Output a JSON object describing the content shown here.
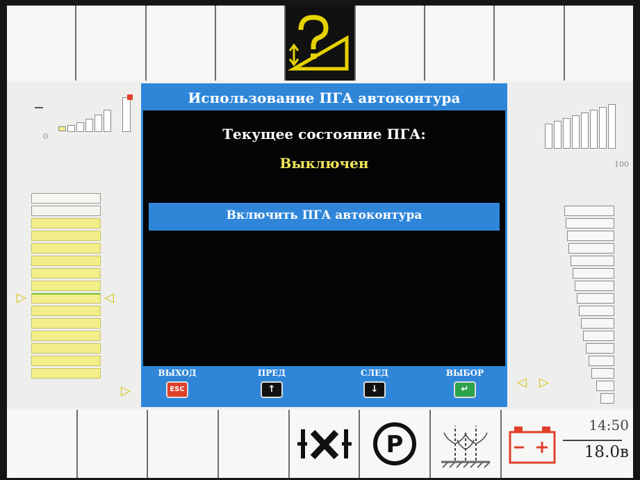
{
  "dialog": {
    "title": "Использование ПГА автоконтура",
    "state_label": "Текущее состояние ПГА:",
    "state_value": "Выключен",
    "option": "Включить ПГА автоконтура"
  },
  "softkeys": [
    {
      "label": "ВЫХОД",
      "key": "ESC",
      "color": "#e0402a"
    },
    {
      "label": "ПРЕД",
      "key": "up-arrow-icon",
      "color": "#111111"
    },
    {
      "label": "СЛЕД",
      "key": "down-arrow-icon",
      "color": "#111111"
    },
    {
      "label": "ВЫБОР",
      "key": "enter-icon",
      "color": "#2aa34a"
    }
  ],
  "left_scale": {
    "min": "0",
    "minus": "−"
  },
  "right_scale": {
    "max": "100"
  },
  "status": {
    "time": "14:50",
    "voltage": "18.0в"
  },
  "colors": {
    "accent": "#2f86d9",
    "highlight": "#f0e65a",
    "battery": "#e0402a"
  }
}
